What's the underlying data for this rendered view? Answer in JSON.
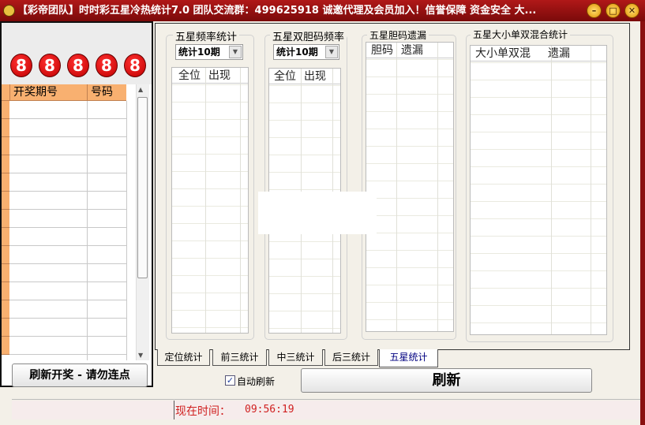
{
  "window": {
    "title": "【彩帝团队】时时彩五星冷热统计7.0 团队交流群：499625918  诚邀代理及会员加入！信誉保障 资金安全 大...",
    "buttons": {
      "minimize": "–",
      "maximize": "□",
      "close": "✕"
    }
  },
  "left": {
    "balls": [
      "8",
      "8",
      "8",
      "8",
      "8"
    ],
    "table": {
      "headers": [
        "开奖期号",
        "号码"
      ],
      "rows": 14
    },
    "refresh_button": "刷新开奖 - 请勿连点"
  },
  "groups": [
    {
      "title": "五星频率统计",
      "dropdown": "统计10期",
      "headers": [
        "全位",
        "出现"
      ]
    },
    {
      "title": "五星双胆码频率",
      "dropdown": "统计10期",
      "headers": [
        "全位",
        "出现"
      ]
    },
    {
      "title": "五星胆码遗漏",
      "headers": [
        "胆码",
        "遗漏"
      ]
    },
    {
      "title": "五星大小单双混合统计",
      "headers": [
        "大小单双混",
        "遗漏"
      ]
    }
  ],
  "tabs": [
    "定位统计",
    "前三统计",
    "中三统计",
    "后三统计",
    "五星统计"
  ],
  "selected_tab": "五星统计",
  "auto_refresh": {
    "label": "自动刷新",
    "checked": true
  },
  "refresh": "刷新",
  "status": {
    "time_label": "现在时间：",
    "time": "09:56:19"
  }
}
